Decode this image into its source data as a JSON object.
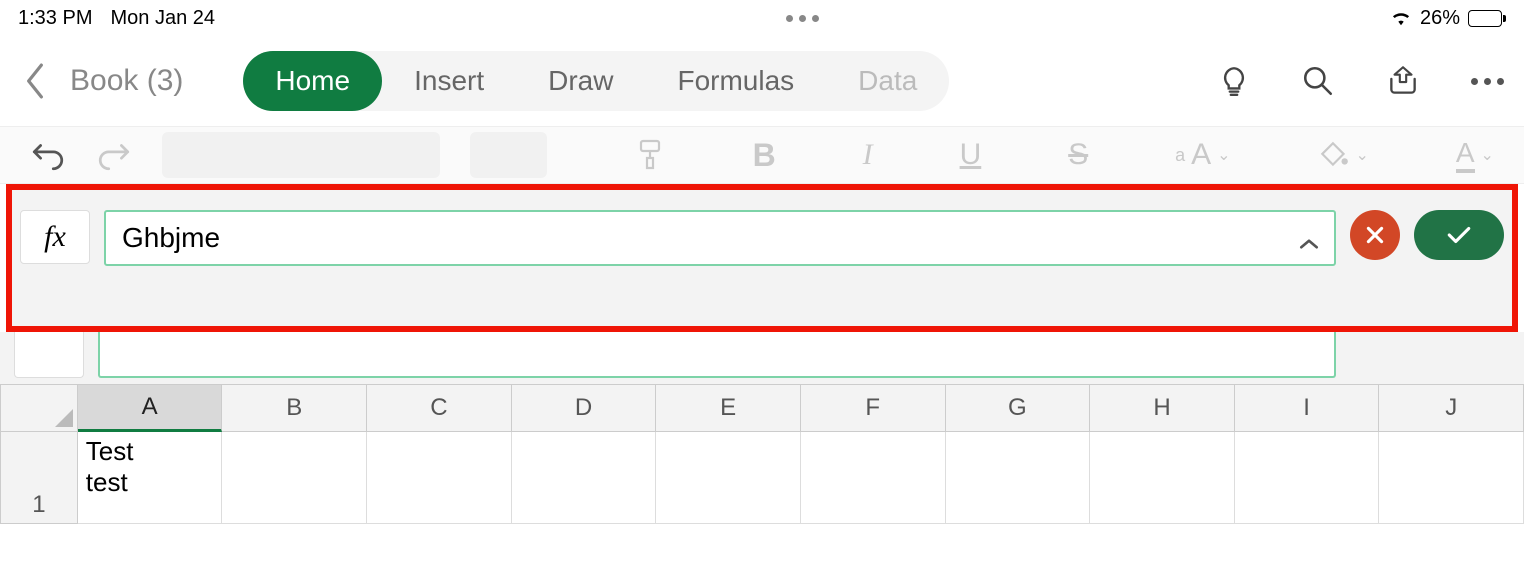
{
  "status": {
    "time": "1:33 PM",
    "date": "Mon Jan 24",
    "battery_pct": "26%"
  },
  "header": {
    "doc_title": "Book (3)",
    "tabs": [
      "Home",
      "Insert",
      "Draw",
      "Formulas",
      "Data"
    ]
  },
  "formula": {
    "fx": "fx",
    "value": "Ghbjme"
  },
  "grid": {
    "columns": [
      "A",
      "B",
      "C",
      "D",
      "E",
      "F",
      "G",
      "H",
      "I",
      "J"
    ],
    "rows": [
      {
        "num": "1",
        "cells": [
          "Test\ntest",
          "",
          "",
          "",
          "",
          "",
          "",
          "",
          "",
          ""
        ]
      }
    ],
    "selected_col": "A"
  }
}
